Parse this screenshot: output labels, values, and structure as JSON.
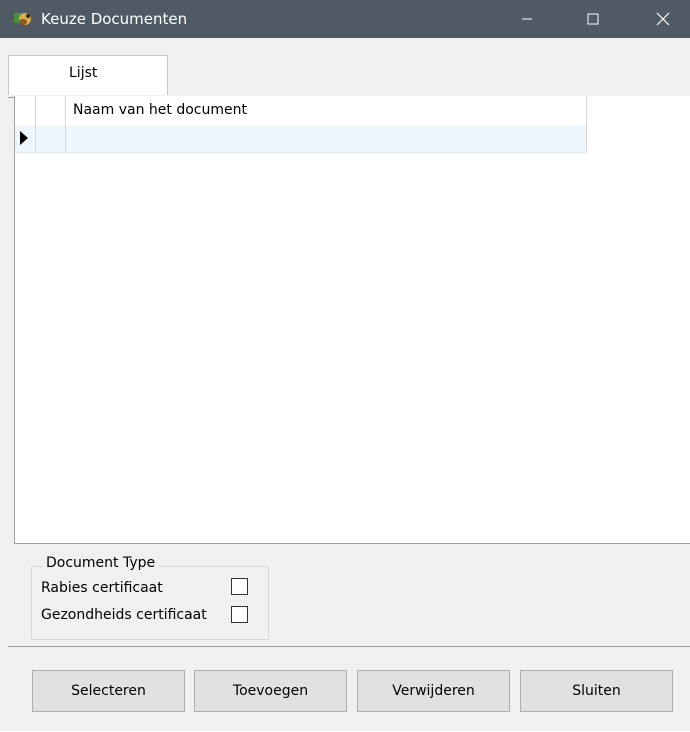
{
  "window": {
    "title": "Keuze Documenten",
    "app_icon": "dog-icon",
    "controls": {
      "minimize": "minimize-icon",
      "maximize": "maximize-icon",
      "close": "close-icon"
    }
  },
  "tabs": [
    {
      "label": "Lijst",
      "selected": true
    }
  ],
  "grid": {
    "columns": [
      "Naam van het document"
    ],
    "rows": [
      {
        "document_name": ""
      }
    ],
    "current_row_marker": "row-pointer-icon"
  },
  "document_type": {
    "legend": "Document Type",
    "options": [
      {
        "label": "Rabies certificaat",
        "checked": false
      },
      {
        "label": "Gezondheids certificaat",
        "checked": false
      }
    ]
  },
  "buttons": {
    "select": "Selecteren",
    "add": "Toevoegen",
    "remove": "Verwijderen",
    "close": "Sluiten"
  },
  "colors": {
    "titlebar": "#505a65",
    "selected_row": "#eef6fd",
    "window_background": "#f0f0f0"
  }
}
